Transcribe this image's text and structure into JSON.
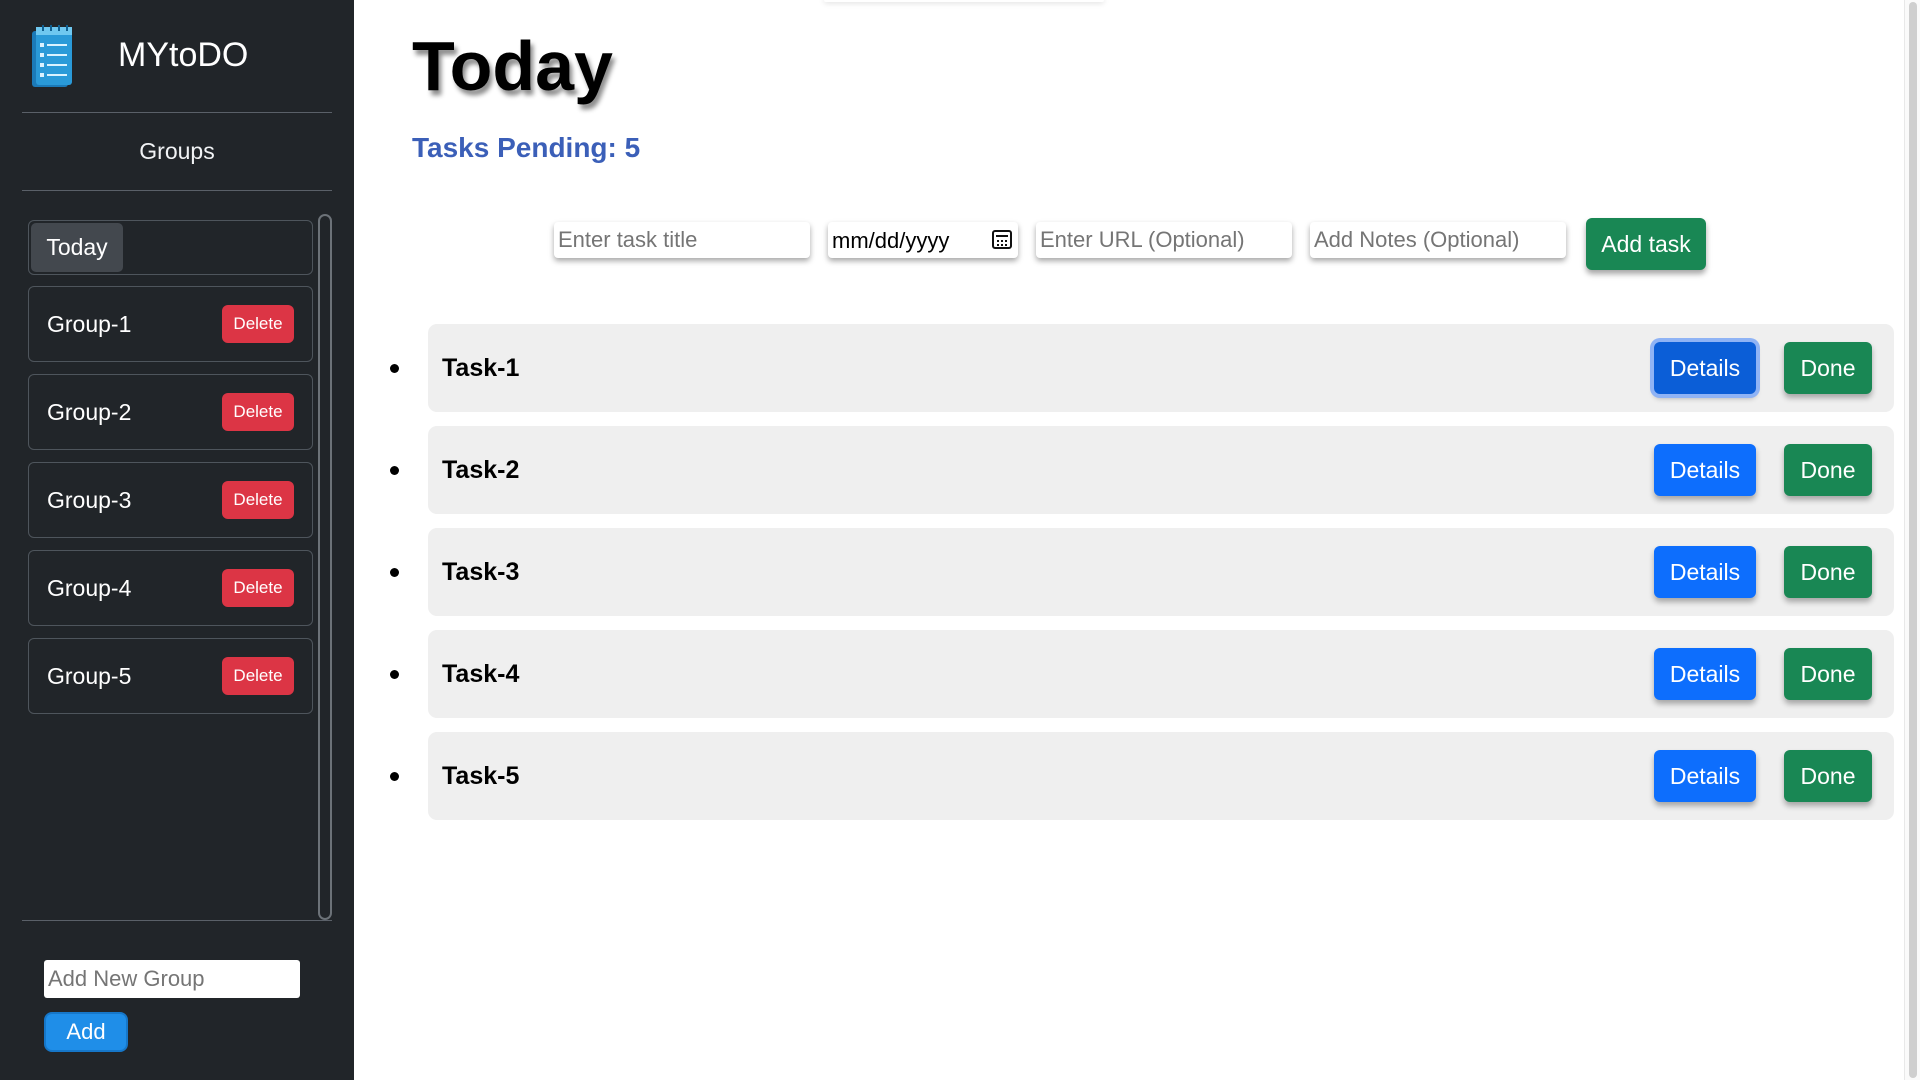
{
  "app": {
    "name": "MYtoDO"
  },
  "sidebar": {
    "groups_title": "Groups",
    "today_label": "Today",
    "groups": [
      {
        "label": "Group-1",
        "delete_label": "Delete"
      },
      {
        "label": "Group-2",
        "delete_label": "Delete"
      },
      {
        "label": "Group-3",
        "delete_label": "Delete"
      },
      {
        "label": "Group-4",
        "delete_label": "Delete"
      },
      {
        "label": "Group-5",
        "delete_label": "Delete"
      }
    ],
    "new_group_placeholder": "Add New Group",
    "add_label": "Add"
  },
  "main": {
    "title": "Today",
    "pending_label": "Tasks Pending:",
    "pending_count": "5",
    "form": {
      "title_placeholder": "Enter task title",
      "date_value": "mm/dd/yyyy",
      "url_placeholder": "Enter URL (Optional)",
      "notes_placeholder": "Add Notes (Optional)",
      "add_task_label": "Add task"
    },
    "tasks": [
      {
        "title": "Task-1",
        "details_label": "Details",
        "done_label": "Done"
      },
      {
        "title": "Task-2",
        "details_label": "Details",
        "done_label": "Done"
      },
      {
        "title": "Task-3",
        "details_label": "Details",
        "done_label": "Done"
      },
      {
        "title": "Task-4",
        "details_label": "Details",
        "done_label": "Done"
      },
      {
        "title": "Task-5",
        "details_label": "Details",
        "done_label": "Done"
      }
    ]
  },
  "colors": {
    "sidebar_bg": "#212529",
    "delete": "#dc3545",
    "primary": "#0d6efd",
    "success": "#198754",
    "pending_text": "#3b5fb8"
  },
  "icons": {
    "logo": "notepad-list-icon",
    "date_picker": "calendar-icon"
  }
}
